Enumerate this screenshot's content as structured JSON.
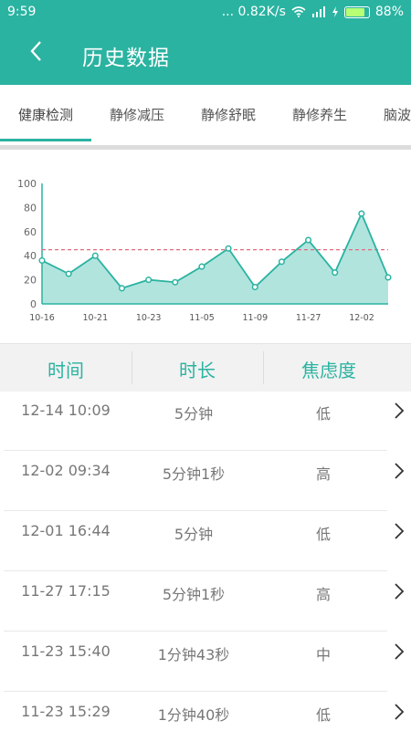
{
  "status_bar": {
    "time": "9:59",
    "network_speed": "... 0.82K/s",
    "battery": "88%",
    "battery_level": 0.88
  },
  "header": {
    "title": "历史数据",
    "back_icon": "chevron-left-icon"
  },
  "tabs": [
    {
      "label": "健康检测",
      "active": true
    },
    {
      "label": "静修减压",
      "active": false
    },
    {
      "label": "静修舒眠",
      "active": false
    },
    {
      "label": "静修养生",
      "active": false
    },
    {
      "label": "脑波",
      "active": false
    }
  ],
  "chart_data": {
    "type": "area",
    "ylim": [
      0,
      100
    ],
    "yticks": [
      "0",
      "20",
      "40",
      "60",
      "80",
      "100"
    ],
    "xtick_labels": [
      "10-16",
      "10-21",
      "10-23",
      "11-05",
      "11-09",
      "11-27",
      "12-02"
    ],
    "values": [
      36,
      25,
      40,
      13,
      20,
      18,
      31,
      46,
      14,
      35,
      53,
      26,
      75,
      22
    ],
    "reference_line": 45,
    "colors": {
      "line": "#2ab3a1",
      "fill": "#b2e4de",
      "reference": "#e36a7c",
      "axis": "#2ab3a1"
    }
  },
  "table": {
    "headers": [
      "时间",
      "时长",
      "焦虑度"
    ],
    "rows": [
      {
        "time": "12-14 10:09",
        "duration": "5分钟",
        "anxiety": "低"
      },
      {
        "time": "12-02 09:34",
        "duration": "5分钟1秒",
        "anxiety": "高"
      },
      {
        "time": "12-01 16:44",
        "duration": "5分钟",
        "anxiety": "低"
      },
      {
        "time": "11-27 17:15",
        "duration": "5分钟1秒",
        "anxiety": "高"
      },
      {
        "time": "11-23 15:40",
        "duration": "1分钟43秒",
        "anxiety": "中"
      },
      {
        "time": "11-23 15:29",
        "duration": "1分钟40秒",
        "anxiety": "低"
      }
    ],
    "row_arrow_icon": "chevron-right-icon"
  },
  "colors": {
    "accent": "#2ab3a1"
  }
}
